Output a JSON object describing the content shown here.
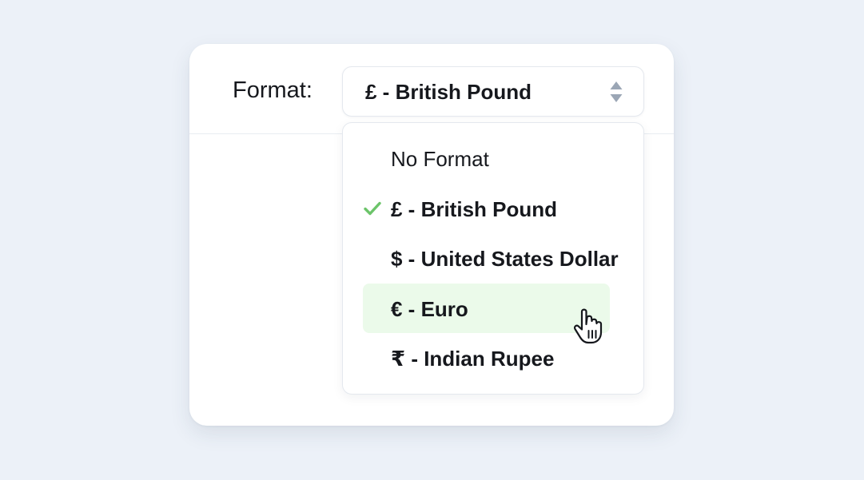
{
  "field": {
    "label": "Format:"
  },
  "select": {
    "value": "£ - British Pound"
  },
  "dropdown": {
    "options": [
      {
        "label": "No Format",
        "selected": false,
        "hovered": false
      },
      {
        "label": "£ - British Pound",
        "selected": true,
        "hovered": false
      },
      {
        "label": "$ - United States Dollar",
        "selected": false,
        "hovered": false
      },
      {
        "label": "€ - Euro",
        "selected": false,
        "hovered": true
      },
      {
        "label": "₹ - Indian Rupee",
        "selected": false,
        "hovered": false
      }
    ]
  },
  "icons": {
    "select_arrows": "sort-arrows-icon",
    "selected_marker": "checkmark-icon",
    "pointer": "hand-pointer-cursor-icon"
  },
  "colors": {
    "background": "#ecf1f8",
    "card": "#ffffff",
    "check": "#6cc46a",
    "hover": "#ebfaea",
    "arrows": "#9ba6b5",
    "text": "#16181d"
  }
}
